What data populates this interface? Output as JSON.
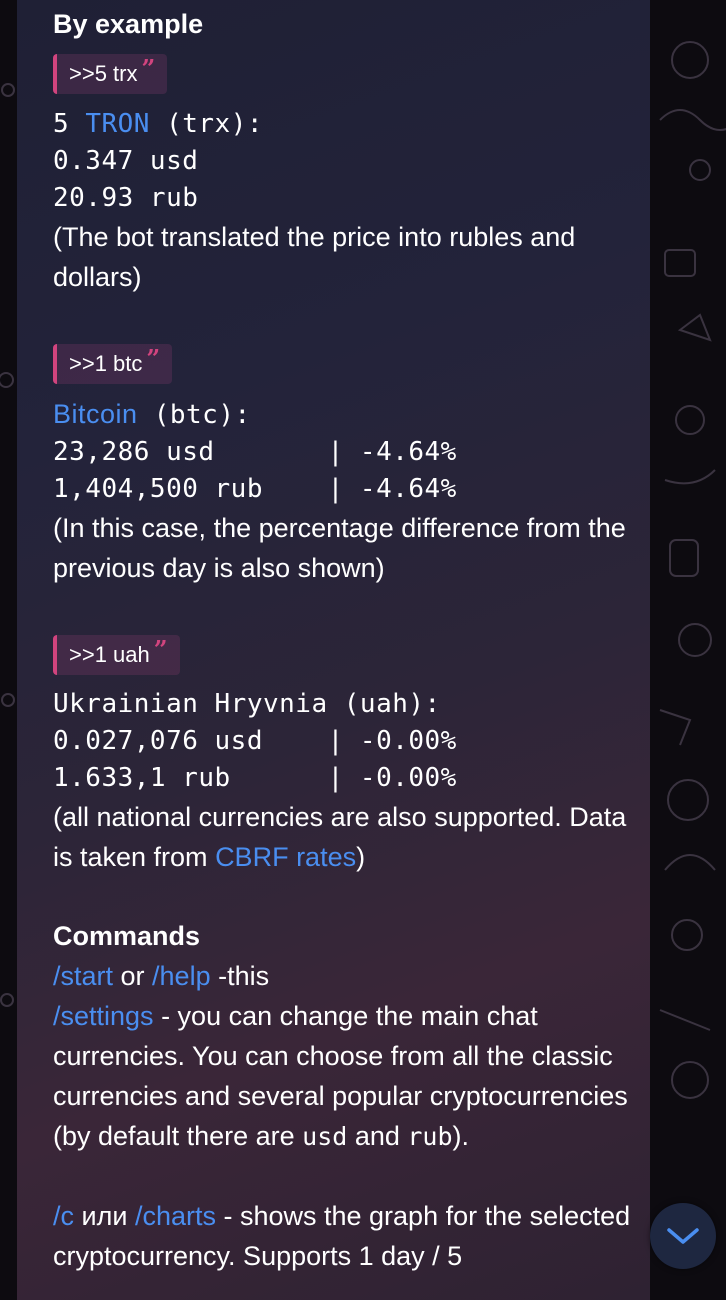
{
  "example": {
    "heading": "By example",
    "q1": {
      "text": ">>5 trx"
    },
    "trx_line1_a": "5 ",
    "trx_line1_link": "TRON",
    "trx_line1_b": " (trx):",
    "trx_line2": "0.347 usd",
    "trx_line3": "20.93 rub",
    "trx_note": "(The bot translated the price into rubles and dollars)",
    "q2": {
      "text": ">>1 btc"
    },
    "btc_line1_link": "Bitcoin",
    "btc_line1_b": " (btc):",
    "btc_line2": "23,286 usd       | -4.64%",
    "btc_line3": "1,404,500 rub    | -4.64%",
    "btc_note": "(In this case, the percentage difference from the previous day is also shown)",
    "q3": {
      "text": ">>1 uah"
    },
    "uah_line1": "Ukrainian Hryvnia (uah):",
    "uah_line2": "0.027,076 usd    | -0.00%",
    "uah_line3": "1.633,1 rub      | -0.00%",
    "uah_note_a": "(all national currencies are also supported. Data is taken from ",
    "uah_note_link": "CBRF rates",
    "uah_note_b": ")"
  },
  "commands": {
    "heading": "Commands",
    "start_link": "/start",
    "or_text": " or ",
    "help_link": "/help",
    "help_desc": " -this",
    "settings_link": "/settings",
    "settings_desc_a": " - you can change the main chat currencies. You can choose from all the classic currencies and several popular cryptocurrencies (by default there are ",
    "settings_usd": "usd",
    "settings_and": " and ",
    "settings_rub": "rub",
    "settings_desc_b": ").",
    "c_link": "/c",
    "ili_text": " или ",
    "charts_link": "/charts",
    "charts_desc": " - shows the graph for the selected cryptocurrency. Supports 1 day / 5"
  },
  "icons": {
    "scroll_down": "chevron-down-icon"
  },
  "colors": {
    "link": "#4a8ef0",
    "quote_accent": "#d1447e",
    "scroll_button": "#1e2740"
  }
}
